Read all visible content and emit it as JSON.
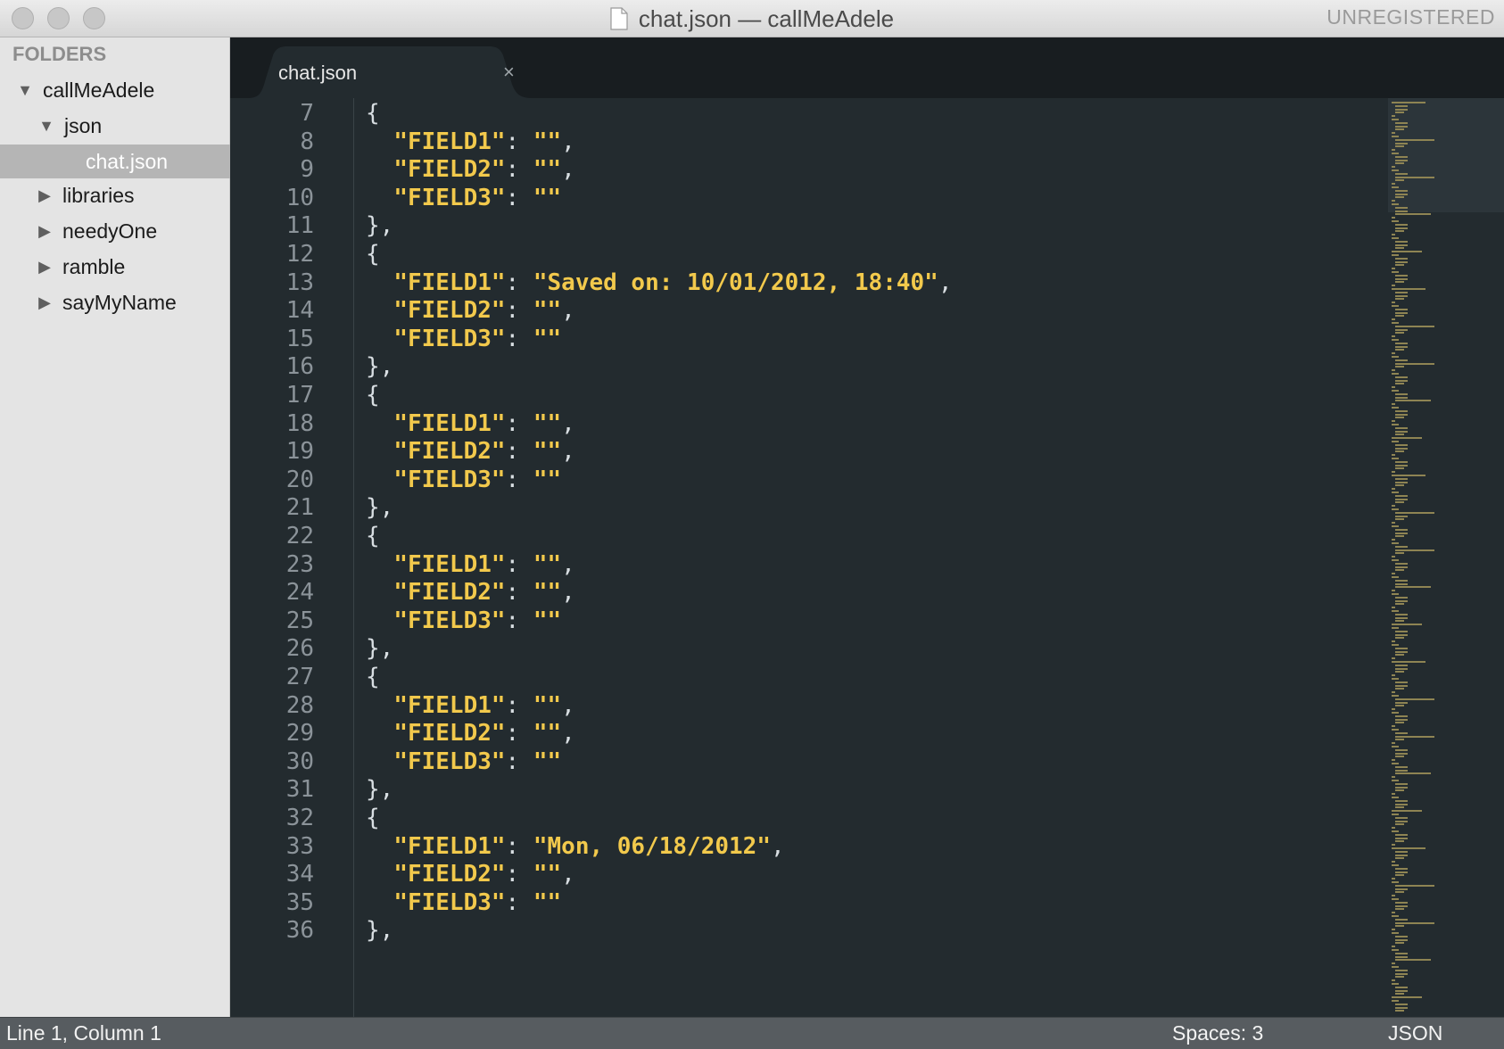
{
  "window": {
    "title": "chat.json — callMeAdele",
    "license": "UNREGISTERED"
  },
  "sidebar": {
    "heading": "FOLDERS",
    "items": [
      {
        "label": "callMeAdele",
        "expanded": true
      },
      {
        "label": "json",
        "expanded": true
      },
      {
        "label": "chat.json",
        "selected": true
      },
      {
        "label": "libraries",
        "expanded": false
      },
      {
        "label": "needyOne",
        "expanded": false
      },
      {
        "label": "ramble",
        "expanded": false
      },
      {
        "label": "sayMyName",
        "expanded": false
      }
    ]
  },
  "tab": {
    "label": "chat.json",
    "close_glyph": "×"
  },
  "editor": {
    "lines": [
      {
        "n": "7",
        "text": "{"
      },
      {
        "n": "8",
        "text": "  \"FIELD1\": \"\","
      },
      {
        "n": "9",
        "text": "  \"FIELD2\": \"\","
      },
      {
        "n": "10",
        "text": "  \"FIELD3\": \"\""
      },
      {
        "n": "11",
        "text": "},"
      },
      {
        "n": "12",
        "text": "{"
      },
      {
        "n": "13",
        "text": "  \"FIELD1\": \"Saved on: 10/01/2012, 18:40\","
      },
      {
        "n": "14",
        "text": "  \"FIELD2\": \"\","
      },
      {
        "n": "15",
        "text": "  \"FIELD3\": \"\""
      },
      {
        "n": "16",
        "text": "},"
      },
      {
        "n": "17",
        "text": "{"
      },
      {
        "n": "18",
        "text": "  \"FIELD1\": \"\","
      },
      {
        "n": "19",
        "text": "  \"FIELD2\": \"\","
      },
      {
        "n": "20",
        "text": "  \"FIELD3\": \"\""
      },
      {
        "n": "21",
        "text": "},"
      },
      {
        "n": "22",
        "text": "{"
      },
      {
        "n": "23",
        "text": "  \"FIELD1\": \"\","
      },
      {
        "n": "24",
        "text": "  \"FIELD2\": \"\","
      },
      {
        "n": "25",
        "text": "  \"FIELD3\": \"\""
      },
      {
        "n": "26",
        "text": "},"
      },
      {
        "n": "27",
        "text": "{"
      },
      {
        "n": "28",
        "text": "  \"FIELD1\": \"\","
      },
      {
        "n": "29",
        "text": "  \"FIELD2\": \"\","
      },
      {
        "n": "30",
        "text": "  \"FIELD3\": \"\""
      },
      {
        "n": "31",
        "text": "},"
      },
      {
        "n": "32",
        "text": "{"
      },
      {
        "n": "33",
        "text": "  \"FIELD1\": \"Mon, 06/18/2012\","
      },
      {
        "n": "34",
        "text": "  \"FIELD2\": \"\","
      },
      {
        "n": "35",
        "text": "  \"FIELD3\": \"\""
      },
      {
        "n": "36",
        "text": "},"
      }
    ]
  },
  "status": {
    "position": "Line 1, Column 1",
    "spaces": "Spaces: 3",
    "syntax": "JSON"
  },
  "colors": {
    "editor_bg": "#232b2f",
    "string": "#f2c94c",
    "line_number": "#8b9399",
    "punctuation": "#d8dee2"
  }
}
